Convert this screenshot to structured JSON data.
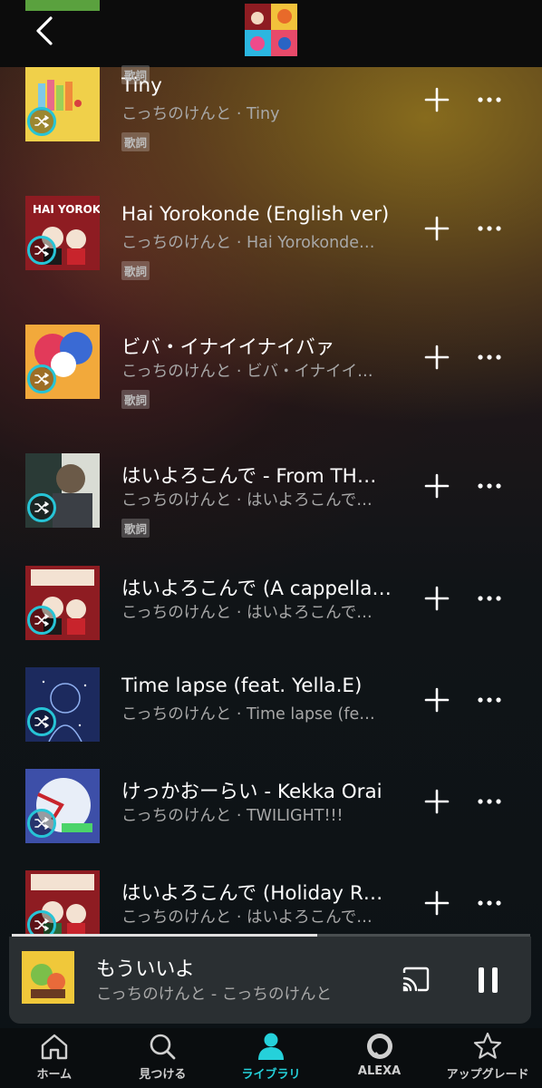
{
  "header": {
    "peek_lyrics_label": "歌詞"
  },
  "tracks": [
    {
      "title": "Tiny",
      "subtitle": "こっちのけんと · Tiny",
      "lyrics": "歌詞",
      "cover_bg": "#f0d04a"
    },
    {
      "title": "Hai Yorokonde (English ver)",
      "subtitle": "こっちのけんと · Hai Yorokonde…",
      "lyrics": "歌詞",
      "cover_bg": "#8e1c22"
    },
    {
      "title": "ビバ・イナイイナイバァ",
      "subtitle": "こっちのけんと · ビバ・イナイイ…",
      "lyrics": "歌詞",
      "cover_bg": "#f2a93b"
    },
    {
      "title": "はいよろこんで - From TH…",
      "subtitle": "こっちのけんと · はいよろこんで…",
      "lyrics": "歌詞",
      "cover_bg": "#d9dcd4"
    },
    {
      "title": "はいよろこんで (A cappella…",
      "subtitle": "こっちのけんと · はいよろこんで…",
      "lyrics": "",
      "cover_bg": "#8e1c22"
    },
    {
      "title": "Time lapse (feat. Yella.E)",
      "subtitle": "こっちのけんと · Time lapse (fe…",
      "lyrics": "",
      "cover_bg": "#1c2a5e"
    },
    {
      "title": "けっかおーらい - Kekka Orai",
      "subtitle": "こっちのけんと · TWILIGHT!!!",
      "lyrics": "",
      "cover_bg": "#3d4fa8"
    },
    {
      "title": "はいよろこんで (Holiday R…",
      "subtitle": "こっちのけんと · はいよろこんで…",
      "lyrics": "",
      "cover_bg": "#8e1c22"
    }
  ],
  "now_playing": {
    "title": "もういいよ",
    "subtitle": "こっちのけんと - こっちのけんと",
    "progress": 0.59
  },
  "nav": [
    {
      "label": "ホーム",
      "icon": "home-icon"
    },
    {
      "label": "見つける",
      "icon": "search-icon"
    },
    {
      "label": "ライブラリ",
      "icon": "library-icon"
    },
    {
      "label": "ALEXA",
      "icon": "alexa-icon"
    },
    {
      "label": "アップグレード",
      "icon": "star-icon"
    }
  ],
  "colors": {
    "accent": "#25d1da",
    "shuffle_ring": "#27c4d6",
    "secondary_text": "#a8a8a8"
  }
}
